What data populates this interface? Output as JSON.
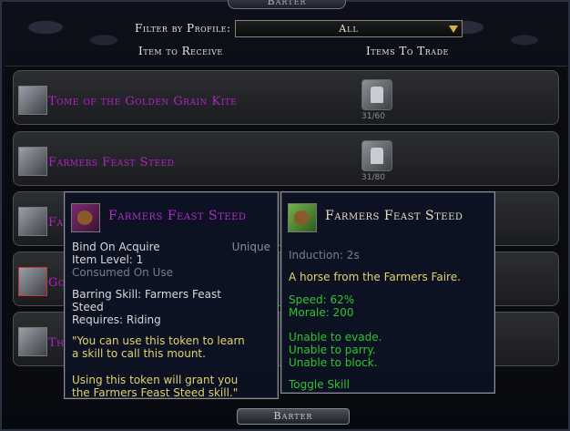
{
  "window": {
    "title": "Barter",
    "filter_label": "Filter by Profile:",
    "filter_value": "All",
    "col_receive": "Item to Receive",
    "col_trade": "Items To Trade",
    "barter_button": "Barter"
  },
  "rows": [
    {
      "name": "Tome of the Golden Grain Kite",
      "count": "31/60",
      "icon": "scroll-icon"
    },
    {
      "name": "Farmers Feast Steed",
      "count": "31/80",
      "icon": "horse-icon"
    },
    {
      "name": "Fa",
      "count": "",
      "icon": "item-icon"
    },
    {
      "name": "Go",
      "count": "",
      "icon": "horse-icon"
    },
    {
      "name": "Th",
      "count": "",
      "icon": "horse-icon"
    }
  ],
  "tooltip_item": {
    "title": "Farmers Feast Steed",
    "bind": "Bind On Acquire",
    "unique": "Unique",
    "item_level": "Item Level: 1",
    "consumed": "Consumed On Use",
    "barring_skill_1": "Barring Skill: Farmers Feast",
    "barring_skill_2": "Steed",
    "requires": "Requires: Riding",
    "quote_1": "\"You can use this token to learn",
    "quote_2": "a skill to call this mount.",
    "quote_3": "Using this token will grant you",
    "quote_4": "the Farmers Feast Steed skill.\""
  },
  "tooltip_skill": {
    "title": "Farmers Feast Steed",
    "induction": "Induction: 2s",
    "description": "A horse from the Farmers Faire.",
    "speed": "Speed: 62%",
    "morale": "Morale: 200",
    "evade": "Unable to evade.",
    "parry": "Unable to parry.",
    "block": "Unable to block.",
    "toggle": "Toggle Skill"
  },
  "colors": {
    "item_name": "#b521c8",
    "flavor_text": "#e2d36b",
    "stat_green": "#2fc42f"
  }
}
